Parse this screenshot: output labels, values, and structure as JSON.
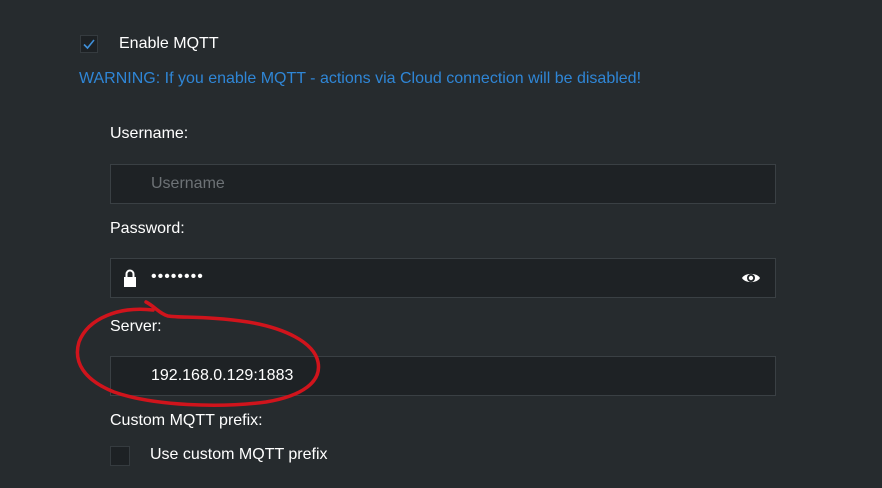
{
  "mqtt": {
    "enable_label": "Enable MQTT",
    "enabled": true,
    "warning": "WARNING: If you enable MQTT - actions via Cloud connection will be disabled!"
  },
  "username": {
    "label": "Username:",
    "value": "",
    "placeholder": "Username"
  },
  "password": {
    "label": "Password:",
    "masked_value": "••••••••"
  },
  "server": {
    "label": "Server:",
    "value": "192.168.0.129:1883"
  },
  "custom_prefix": {
    "label": "Custom MQTT prefix:",
    "checkbox_label": "Use custom MQTT prefix",
    "checked": false
  },
  "colors": {
    "background": "#262b2e",
    "field_background": "#1e2225",
    "warning": "#2f86d6",
    "annotation": "#d0141c"
  },
  "icons": {
    "enable_checkbox": "checkmark-icon",
    "password_prefix": "lock-icon",
    "password_toggle": "eye-icon"
  }
}
